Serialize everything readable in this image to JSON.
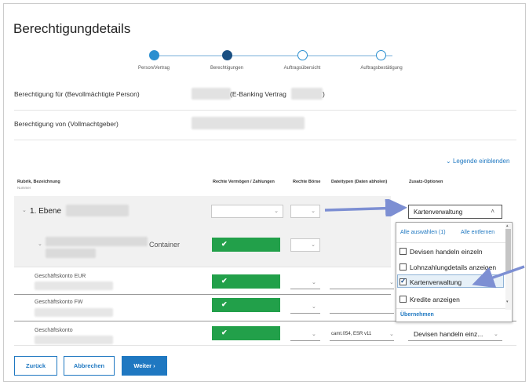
{
  "title": "Berechtigungdetails",
  "steps": [
    {
      "label": "Person/Vertrag",
      "state": "done"
    },
    {
      "label": "Berechtigungen",
      "state": "active"
    },
    {
      "label": "Auftragsübersicht",
      "state": "todo"
    },
    {
      "label": "Auftragsbestätigung",
      "state": "todo"
    }
  ],
  "fields": {
    "berechtigung_fuer_label": "Berechtigung für (Bevollmächtigte Person)",
    "berechtigung_fuer_value": "(E-Banking Vertrag",
    "berechtigung_fuer_value_end": ")",
    "berechtigung_von_label": "Berechtigung von (Vollmachtgeber)"
  },
  "legend_link": "Legende einblenden",
  "table": {
    "headers": {
      "rubrik": "Rubrik, Bezeichnung",
      "rubrik_sub": "Nummer",
      "rechte_vermoegen": "Rechte Vermögen / Zahlungen",
      "rechte_boerse": "Rechte Börse",
      "dateitypen": "Dateitypen (Daten abholen)",
      "zusatz": "Zusatz-Optionen"
    },
    "rows": [
      {
        "label": "1. Ebene"
      },
      {
        "label": "Container"
      },
      {
        "label": "Geschäftskonto EUR"
      },
      {
        "label": "Geschäftskonto FW"
      },
      {
        "label": "Geschäftskonto",
        "dateitypen": "camt.054, ESR v11",
        "zusatz": "Devisen handeln einz..."
      }
    ]
  },
  "dropdown": {
    "selected": "Kartenverwaltung",
    "select_all": "Alle auswählen (1)",
    "remove_all": "Alle entfernen",
    "options": [
      {
        "label": "Devisen handeln einzeln",
        "checked": false
      },
      {
        "label": "Lohnzahlungdetails anzeigen",
        "checked": false
      },
      {
        "label": "Kartenverwaltung",
        "checked": true
      },
      {
        "label": "Kredite anzeigen",
        "checked": false
      }
    ],
    "apply": "Übernehmen"
  },
  "buttons": {
    "back": "Zurück",
    "cancel": "Abbrechen",
    "next": "Weiter ›"
  },
  "colors": {
    "accent": "#1f78c1",
    "green": "#22a04a",
    "arrow": "#7d8fd3"
  }
}
